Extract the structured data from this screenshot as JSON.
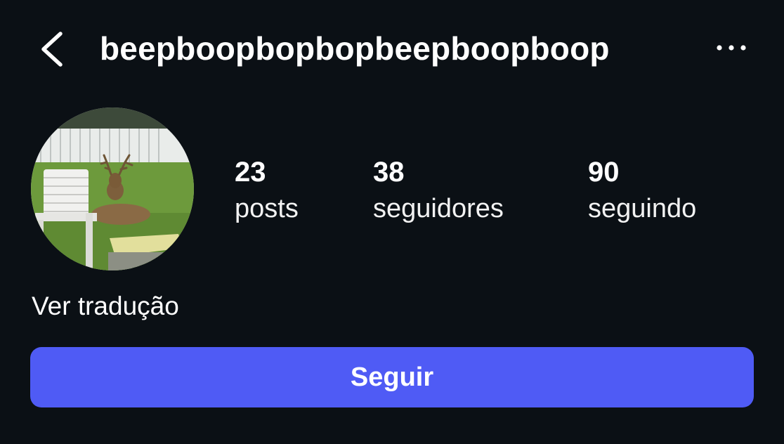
{
  "header": {
    "username": "beepboopbopbopbeepboopboop",
    "back_icon": "chevron-left-icon",
    "more_icon": "more-horizontal-icon"
  },
  "profile": {
    "avatar_description_icon": "profile-photo-deer",
    "stats": [
      {
        "value": "23",
        "label": "posts"
      },
      {
        "value": "38",
        "label": "seguidores"
      },
      {
        "value": "90",
        "label": "seguindo"
      }
    ]
  },
  "bio": {
    "translate_label": "Ver tradução"
  },
  "actions": {
    "follow_label": "Seguir"
  },
  "colors": {
    "background": "#0b1015",
    "accent": "#4f5bf5",
    "text": "#ffffff"
  }
}
